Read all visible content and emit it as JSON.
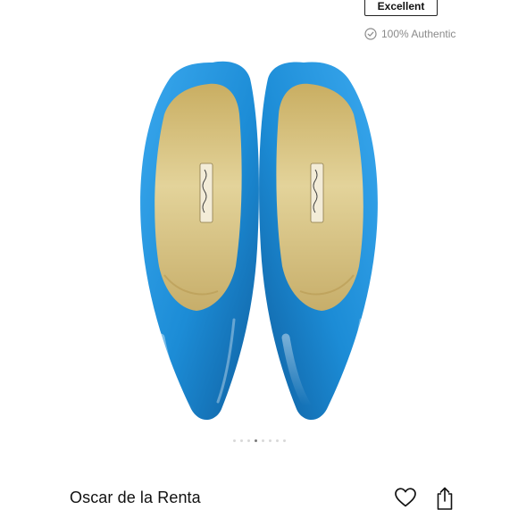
{
  "listing": {
    "condition_label": "Excellent",
    "authentic_label": "100% Authentic",
    "title": "Oscar de la Renta"
  },
  "gallery": {
    "image_description": "Pair of blue patent leather pointed-toe pumps, front view",
    "dot_count": 8,
    "active_index": 3
  },
  "icons": {
    "authentic": "check-circle-icon",
    "like": "heart-icon",
    "share": "share-icon"
  },
  "colors": {
    "shoe_blue": "#1E8FD8",
    "insole_gold": "#D8C27A",
    "muted_text": "#8a8a8a"
  }
}
